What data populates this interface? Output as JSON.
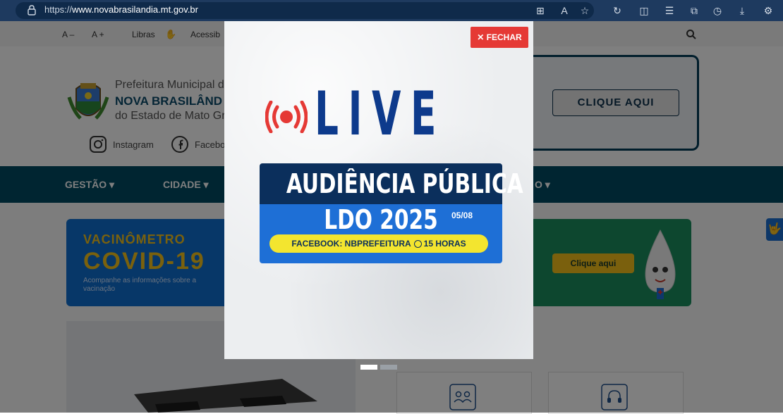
{
  "browser": {
    "url_prefix": "https://",
    "url_domain": "www.novabrasilandia.mt.gov.br"
  },
  "topbar": {
    "font_decrease": "A –",
    "font_increase": "A +",
    "libras": "Libras",
    "acessibilidade": "Acessib"
  },
  "header": {
    "line1": "Prefeitura Municipal de",
    "line2": "NOVA BRASILÂND",
    "line3": "do Estado de Mato Gro",
    "instagram": "Instagram",
    "facebook": "Facebo",
    "banner_button": "CLIQUE AQUI"
  },
  "nav": {
    "items": [
      "GESTÃO ▾",
      "CIDADE ▾",
      "O ▾"
    ]
  },
  "content": {
    "vacina_title": "VACINÔMETRO",
    "covid_title": "COVID-19",
    "vacina_sub": "Acompanhe as informações sobre a vacinação",
    "right_button": "Clique aqui"
  },
  "modal": {
    "close_label": "✕ FECHAR",
    "live": "LIVE",
    "audiencia": "AUDIÊNCIA PÚBLICA",
    "ldo": "LDO 2025",
    "date": "05/08",
    "facebook_prefix": "FACEBOOK: NBPREFEITURA",
    "facebook_time": "15 HORAS"
  },
  "colors": {
    "close_button": "#e53935",
    "live_blue": "#0d3a8c",
    "navbar": "#004a63"
  }
}
